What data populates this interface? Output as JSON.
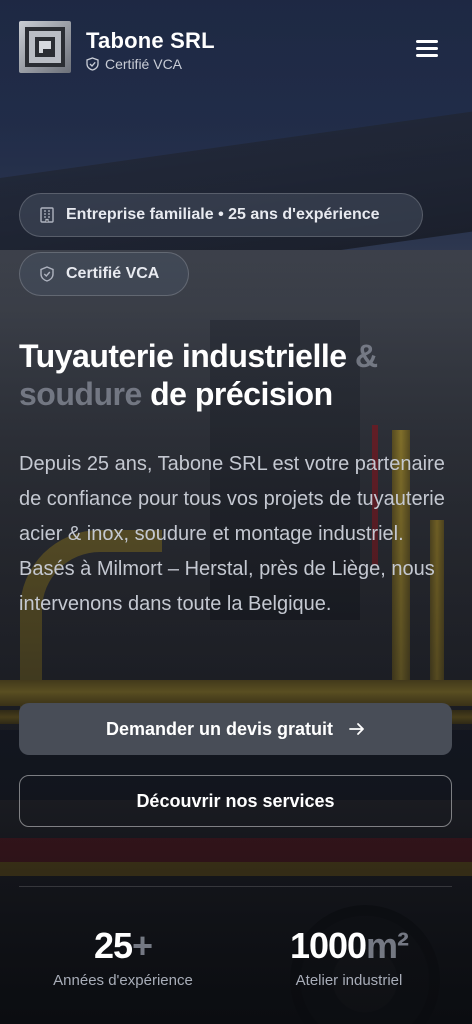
{
  "header": {
    "brand": "Tabone SRL",
    "certification": "Certifié VCA",
    "menu_icon": "hamburger-menu-icon"
  },
  "badges": [
    {
      "icon": "building-icon",
      "label": "Entreprise familiale • 25 ans d'expérience"
    },
    {
      "icon": "shield-icon",
      "label": "Certifié VCA"
    }
  ],
  "hero": {
    "title_part1": "Tuyauterie industrielle ",
    "title_part2": "& soudure",
    "title_part3": " de précision",
    "description": "Depuis 25 ans, Tabone SRL est votre partenaire de confiance pour tous vos projets de tuyauterie acier & inox, soudure et montage industriel. Basés à Milmort – Herstal, près de Liège, nous intervenons dans toute la Belgique."
  },
  "actions": {
    "primary_label": "Demander un devis gratuit",
    "primary_icon": "arrow-right-icon",
    "secondary_label": "Découvrir nos services"
  },
  "stats": [
    {
      "value": "25",
      "suffix": "+",
      "label": "Années d'expérience"
    },
    {
      "value": "1000",
      "suffix": "m²",
      "label": "Atelier industriel"
    }
  ],
  "colors": {
    "primary_button": "#484d57",
    "muted_text": "#a0a5b2"
  }
}
